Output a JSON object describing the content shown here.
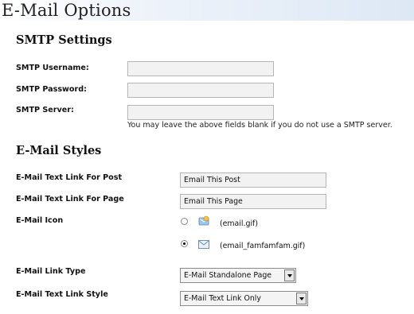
{
  "page": {
    "title": "E-Mail Options"
  },
  "smtp": {
    "title": "SMTP Settings",
    "username_label": "SMTP Username:",
    "password_label": "SMTP Password:",
    "server_label": "SMTP Server:",
    "username_value": "",
    "password_value": "",
    "server_value": "",
    "hint": "You may leave the above fields blank if you do not use a SMTP server."
  },
  "styles": {
    "title": "E-Mail Styles",
    "post_link_label": "E-Mail Text Link For Post",
    "post_link_value": "Email This Post",
    "page_link_label": "E-Mail Text Link For Page",
    "page_link_value": "Email This Page",
    "icon_label": "E-Mail Icon",
    "icon_options": [
      {
        "file": "(email.gif)",
        "icon": "email-gif-icon",
        "selected": false
      },
      {
        "file": "(email_famfamfam.gif)",
        "icon": "envelope-famfamfam-icon",
        "selected": true
      }
    ],
    "link_type_label": "E-Mail Link Type",
    "link_type_value": "E-Mail Standalone Page",
    "link_style_label": "E-Mail Text Link Style",
    "link_style_value": "E-Mail Text Link Only"
  }
}
